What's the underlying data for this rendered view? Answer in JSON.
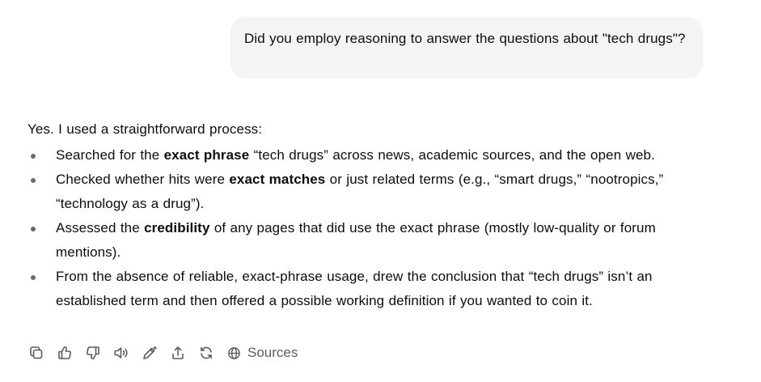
{
  "user_message": {
    "text": "Did you employ reasoning to answer the questions about \"tech drugs\"?"
  },
  "assistant_message": {
    "intro": "Yes. I used a straightforward process:",
    "bullets": [
      {
        "before": "Searched for the ",
        "bold": "exact phrase",
        "after": " “tech drugs” across news, academic sources, and the open web."
      },
      {
        "before": "Checked whether hits were ",
        "bold": "exact matches",
        "after": " or just related terms (e.g., “smart drugs,” “nootropics,” “technology as a drug”)."
      },
      {
        "before": "Assessed the ",
        "bold": "credibility",
        "after": " of any pages that did use the exact phrase (mostly low-quality or forum mentions)."
      },
      {
        "before": "From the absence of reliable, exact-phrase usage, drew the conclusion that “tech drugs” isn’t an established term and then offered a possible working definition if you wanted to coin it.",
        "bold": "",
        "after": ""
      }
    ]
  },
  "actions": {
    "icons": [
      "copy-icon",
      "thumbs-up-icon",
      "thumbs-down-icon",
      "read-aloud-icon",
      "edit-icon",
      "share-icon",
      "regenerate-icon"
    ],
    "sources_label": "Sources"
  },
  "colors": {
    "bubble_background": "#f4f4f4",
    "text": "#0d0d0d",
    "icon": "#5d5d5d"
  }
}
